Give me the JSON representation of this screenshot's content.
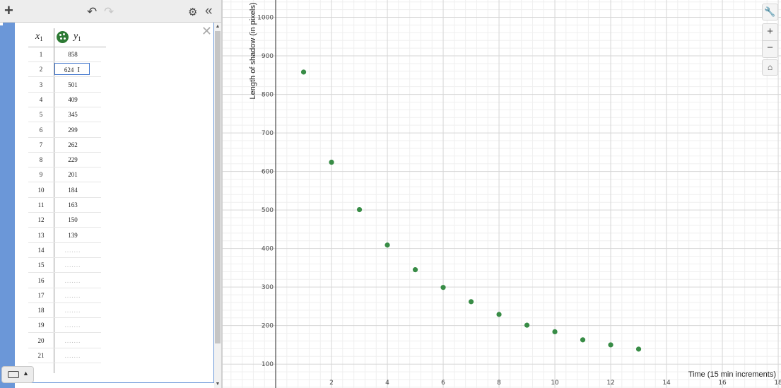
{
  "toolbar": {
    "add_icon": "plus-icon",
    "undo_icon": "undo-icon",
    "redo_icon": "redo-icon",
    "settings_icon": "gear-icon",
    "collapse_icon": "double-chevron-left-icon"
  },
  "table": {
    "x_header": "x",
    "x_sub": "1",
    "y_header": "y",
    "y_sub": "1",
    "rows": [
      {
        "x": "1",
        "y": "858"
      },
      {
        "x": "2",
        "y": "624"
      },
      {
        "x": "3",
        "y": "501"
      },
      {
        "x": "4",
        "y": "409"
      },
      {
        "x": "5",
        "y": "345"
      },
      {
        "x": "6",
        "y": "299"
      },
      {
        "x": "7",
        "y": "262"
      },
      {
        "x": "8",
        "y": "229"
      },
      {
        "x": "9",
        "y": "201"
      },
      {
        "x": "10",
        "y": "184"
      },
      {
        "x": "11",
        "y": "163"
      },
      {
        "x": "12",
        "y": "150"
      },
      {
        "x": "13",
        "y": "139"
      },
      {
        "x": "14",
        "y": ""
      },
      {
        "x": "15",
        "y": ""
      },
      {
        "x": "16",
        "y": ""
      },
      {
        "x": "17",
        "y": ""
      },
      {
        "x": "18",
        "y": ""
      },
      {
        "x": "19",
        "y": ""
      },
      {
        "x": "20",
        "y": ""
      },
      {
        "x": "21",
        "y": ""
      }
    ],
    "active_row": 1
  },
  "chart_data": {
    "type": "scatter",
    "x": [
      1,
      2,
      3,
      4,
      5,
      6,
      7,
      8,
      9,
      10,
      11,
      12,
      13
    ],
    "y": [
      858,
      624,
      501,
      409,
      345,
      299,
      262,
      229,
      201,
      184,
      163,
      150,
      139
    ],
    "xlabel": "Time (15 min increments)",
    "ylabel": "Length of shadow (in pixels)",
    "xlim": [
      -1.9,
      18.1
    ],
    "ylim": [
      38,
      1045
    ],
    "x_ticks": [
      2,
      4,
      6,
      8,
      10,
      12,
      14,
      16,
      18
    ],
    "y_ticks": [
      100,
      200,
      300,
      400,
      500,
      600,
      700,
      800,
      900,
      1000
    ],
    "point_color": "#388c46",
    "grid": true
  },
  "controls": {
    "wrench_icon": "wrench-icon",
    "zoom_in": "+",
    "zoom_out": "−",
    "home_icon": "home-icon"
  }
}
